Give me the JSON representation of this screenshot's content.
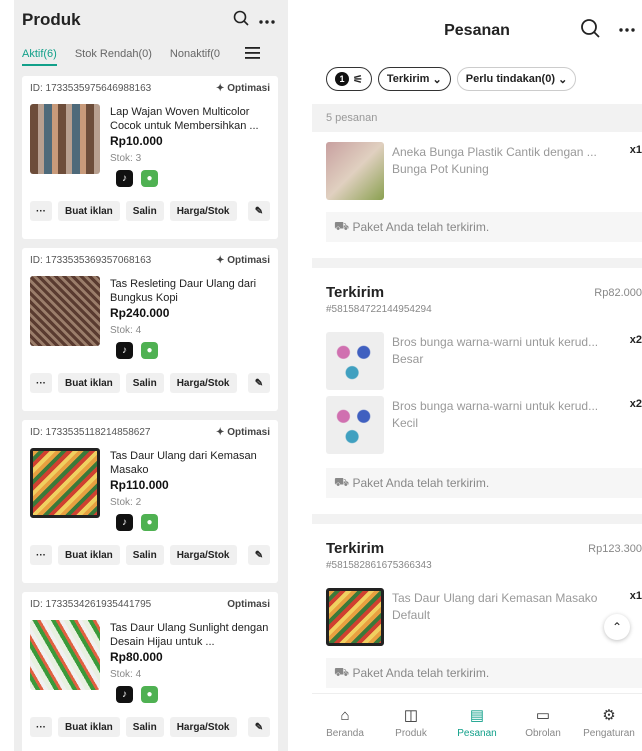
{
  "left": {
    "title": "Produk",
    "tabs": [
      "Aktif(6)",
      "Stok Rendah(0)",
      "Nonaktif(0"
    ],
    "products": [
      {
        "id": "ID: 1733535975646988163",
        "optimize": "Optimasi",
        "name": "Lap Wajan Woven Multicolor Cocok untuk Membersihkan ...",
        "price": "Rp10.000",
        "stock": "Stok: 3"
      },
      {
        "id": "ID: 1733535369357068163",
        "optimize": "Optimasi",
        "name": "Tas Resleting Daur Ulang dari Bungkus Kopi",
        "price": "Rp240.000",
        "stock": "Stok: 4"
      },
      {
        "id": "ID: 1733535118214858627",
        "optimize": "Optimasi",
        "name": "Tas Daur Ulang dari Kemasan Masako",
        "price": "Rp110.000",
        "stock": "Stok: 2"
      },
      {
        "id": "ID: 1733534261935441795",
        "optimize": "Optimasi",
        "name": "Tas Daur Ulang Sunlight dengan Desain Hijau untuk ...",
        "price": "Rp80.000",
        "stock": "Stok: 4"
      }
    ],
    "buttons": {
      "more": "···",
      "ads": "Buat iklan",
      "copy": "Salin",
      "price_stock": "Harga/Stok"
    }
  },
  "right": {
    "title": "Pesanan",
    "filters": {
      "badge": "1",
      "status": "Terkirim",
      "action": "Perlu tindakan(0)"
    },
    "count": "5 pesanan",
    "first_item": {
      "name": "Aneka Bunga Plastik Cantik dengan ... Bunga Pot Kuning",
      "qty": "x1"
    },
    "package_msg": "Paket Anda telah terkirim.",
    "orders": [
      {
        "status": "Terkirim",
        "order_no": "#581584722144954294",
        "total": "Rp82.000",
        "items": [
          {
            "name": "Bros bunga warna-warni untuk kerud... Besar",
            "qty": "x2"
          },
          {
            "name": "Bros bunga warna-warni untuk kerud... Kecil",
            "qty": "x2"
          }
        ]
      },
      {
        "status": "Terkirim",
        "order_no": "#581582861675366343",
        "total": "Rp123.300",
        "items": [
          {
            "name": "Tas Daur Ulang dari Kemasan Masako Default",
            "qty": "x1"
          }
        ]
      }
    ],
    "nav": [
      "Beranda",
      "Produk",
      "Pesanan",
      "Obrolan",
      "Pengaturan"
    ]
  },
  "icons": {
    "search": "search-icon",
    "more": "more-icon",
    "menu": "menu-icon",
    "tiktok": "tiktok-icon",
    "tokopedia": "tokopedia-icon"
  },
  "colors": {
    "accent": "#12a08a"
  }
}
